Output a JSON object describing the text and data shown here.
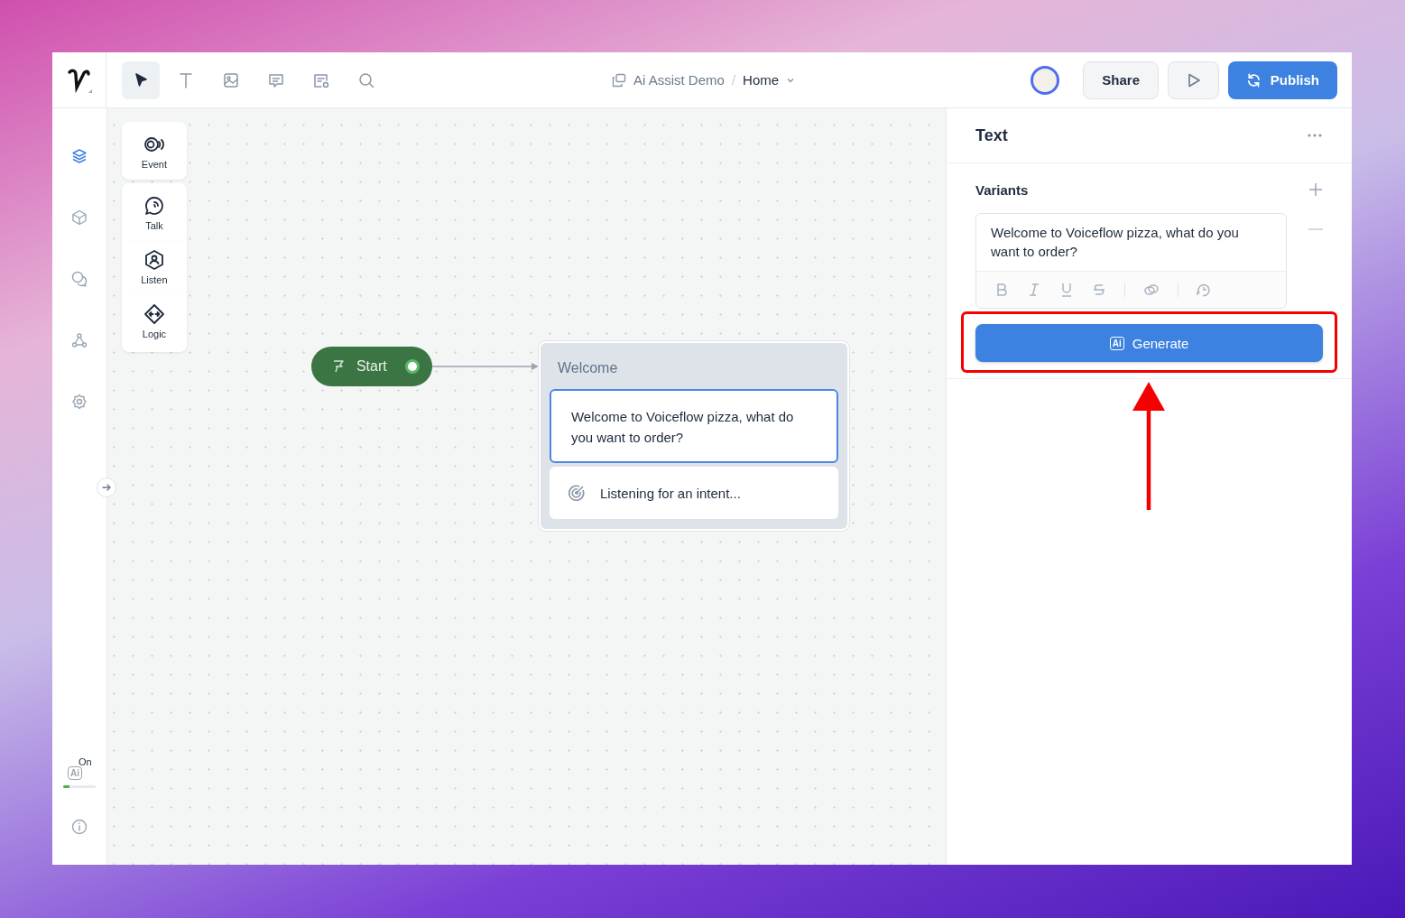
{
  "toolbar": {
    "tools": [
      {
        "selected": true
      },
      {
        "selected": false
      },
      {
        "selected": false
      },
      {
        "selected": false
      },
      {
        "selected": false
      },
      {
        "selected": false
      }
    ]
  },
  "breadcrumb": {
    "project": "Ai Assist Demo",
    "separator": "/",
    "page": "Home"
  },
  "actions": {
    "share": "Share",
    "publish": "Publish"
  },
  "sidebar": {
    "items": [
      {
        "selected": true
      },
      {
        "selected": false
      },
      {
        "selected": false
      },
      {
        "selected": false
      },
      {
        "selected": false
      }
    ],
    "ai_badge": "Ai",
    "ai_status": "On",
    "ai_level": {
      "level": 0.2
    }
  },
  "block_palette": [
    {
      "label": "Event"
    },
    {
      "label": "Talk"
    },
    {
      "label": "Listen"
    },
    {
      "label": "Logic"
    }
  ],
  "canvas": {
    "start": {
      "label": "Start"
    },
    "block": {
      "title": "Welcome",
      "message": "Welcome to Voiceflow pizza, what do you want to order?",
      "listening": "Listening for an intent..."
    }
  },
  "panel": {
    "title": "Text",
    "variants_label": "Variants",
    "variant_text": "Welcome to Voiceflow pizza, what do you want to order?",
    "generate": {
      "badge": "Ai",
      "label": "Generate"
    }
  }
}
